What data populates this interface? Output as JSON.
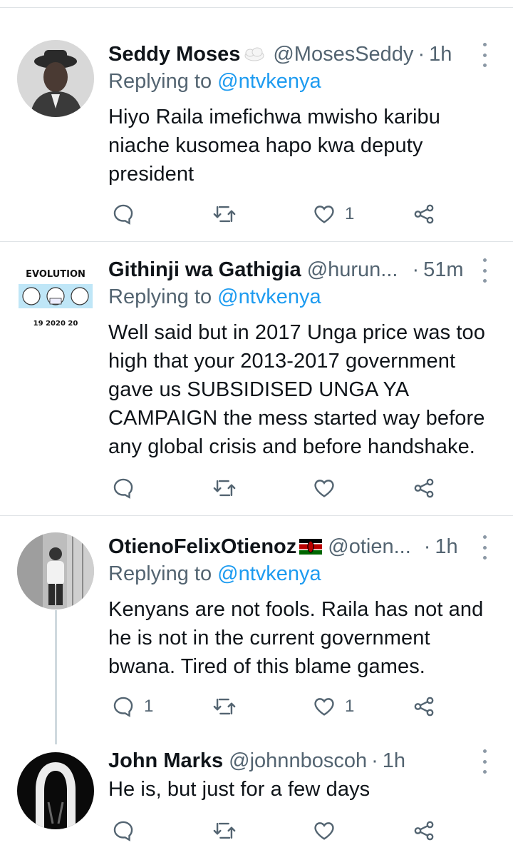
{
  "tweets": [
    {
      "name": "Seddy Moses",
      "handle": "@MosesSeddy",
      "sep": "·",
      "time": "1h",
      "replying_prefix": "Replying to ",
      "replying_to": "@ntvkenya",
      "text": "Hiyo Raila imefichwa mwisho karibu niache kusomea hapo kwa deputy president",
      "replies": "",
      "retweets": "",
      "likes": "1"
    },
    {
      "name": "Githinji wa Gathigia",
      "handle": "@hurun...",
      "sep": "·",
      "time": "51m",
      "replying_prefix": "Replying to ",
      "replying_to": "@ntvkenya",
      "text": "Well said but in 2017 Unga price was too high that your 2013-2017 government gave us SUBSIDISED UNGA YA CAMPAIGN the mess started way before any global crisis and before handshake.",
      "replies": "",
      "retweets": "",
      "likes": "",
      "avatar_text": "EVOLUTION",
      "avatar_years": "19   2020   20"
    },
    {
      "name": "OtienoFelixOtienoz",
      "handle": "@otien...",
      "sep": "·",
      "time": "1h",
      "replying_prefix": "Replying to ",
      "replying_to": "@ntvkenya",
      "text": "Kenyans are not fools. Raila has not and he is not in the current government bwana. Tired of this blame games.",
      "replies": "1",
      "retweets": "",
      "likes": "1"
    },
    {
      "name": "John Marks",
      "handle": "@johnnboscoh",
      "sep": "·",
      "time": "1h",
      "text": "He is, but just for a few days",
      "replies": "",
      "retweets": "",
      "likes": ""
    }
  ]
}
